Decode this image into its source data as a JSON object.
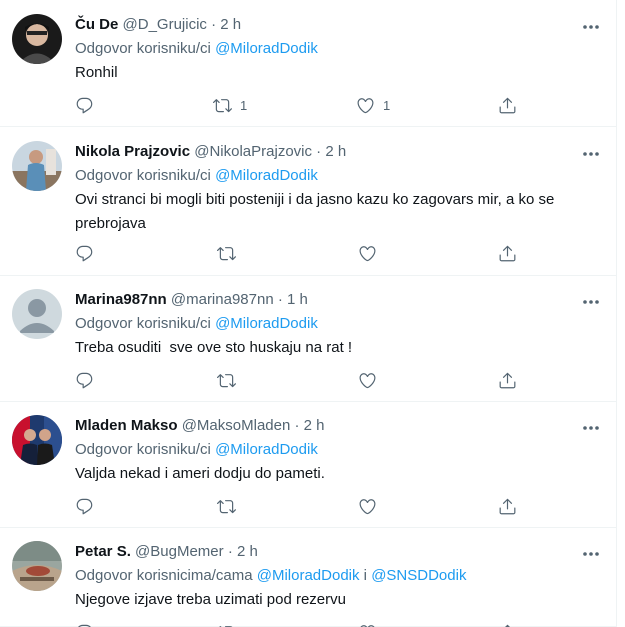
{
  "tweets": [
    {
      "name": "Ču De",
      "handle": "@D_Grujicic",
      "time": "2 h",
      "reply_prefix": "Odgovor korisniku/ci",
      "mentions": [
        "@MiloradDodik"
      ],
      "mention_joiner": "",
      "text": "Ronhil",
      "reply_count": "",
      "retweet_count": "1",
      "like_count": "1"
    },
    {
      "name": "Nikola Prajzovic",
      "handle": "@NikolaPrajzovic",
      "time": "2 h",
      "reply_prefix": "Odgovor korisniku/ci",
      "mentions": [
        "@MiloradDodik"
      ],
      "mention_joiner": "",
      "text": "Ovi stranci bi mogli biti posteniji i da jasno kazu ko zagovars mir, a ko se prebrojava",
      "reply_count": "",
      "retweet_count": "",
      "like_count": ""
    },
    {
      "name": "Marina987nn",
      "handle": "@marina987nn",
      "time": "1 h",
      "reply_prefix": "Odgovor korisniku/ci",
      "mentions": [
        "@MiloradDodik"
      ],
      "mention_joiner": "",
      "text": "Treba osuditi  sve ove sto huskaju na rat !",
      "reply_count": "",
      "retweet_count": "",
      "like_count": ""
    },
    {
      "name": "Mladen Makso",
      "handle": "@MaksoMladen",
      "time": "2 h",
      "reply_prefix": "Odgovor korisniku/ci",
      "mentions": [
        "@MiloradDodik"
      ],
      "mention_joiner": "",
      "text": "Valjda nekad i ameri dodju do pameti.",
      "reply_count": "",
      "retweet_count": "",
      "like_count": ""
    },
    {
      "name": "Petar S.",
      "handle": "@BugMemer",
      "time": "2 h",
      "reply_prefix": "Odgovor korisnicima/cama",
      "mentions": [
        "@MiloradDodik",
        "@SNSDDodik"
      ],
      "mention_joiner": "i",
      "text": "Njegove izjave treba uzimati pod rezervu",
      "reply_count": "",
      "retweet_count": "",
      "like_count": ""
    }
  ],
  "separator": "·",
  "icons": {
    "more": "more-horizontal-icon",
    "reply": "reply-icon",
    "retweet": "retweet-icon",
    "like": "heart-icon",
    "share": "share-icon"
  },
  "colors": {
    "text": "#0f1419",
    "muted": "#536471",
    "link": "#1d9bf0",
    "border": "#eff3f4",
    "background": "#ffffff"
  }
}
